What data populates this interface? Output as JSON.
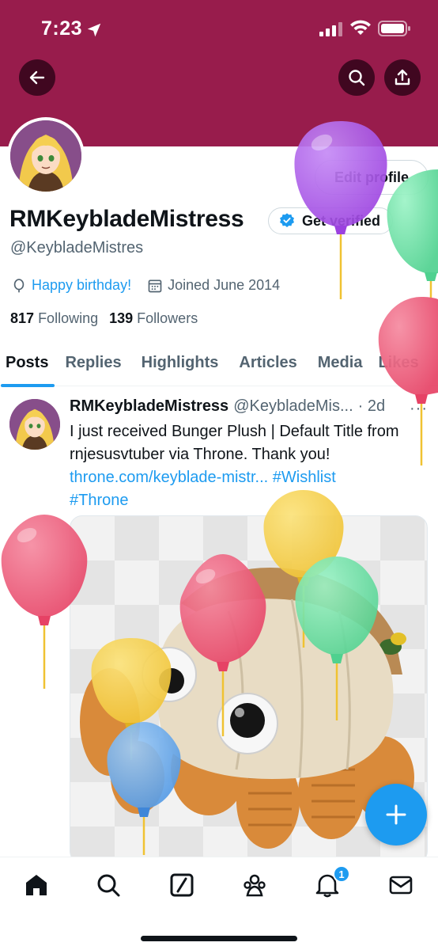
{
  "status_bar": {
    "time": "7:23"
  },
  "header": {
    "back_icon": "arrow-left-icon",
    "search_icon": "search-icon",
    "share_icon": "share-icon"
  },
  "profile": {
    "edit_label": "Edit profile",
    "display_name": "RMKeybladeMistress",
    "verify_label": "Get verified",
    "handle": "@KeybladeMistres",
    "birthday": "Happy birthday!",
    "joined": "Joined June 2014",
    "following_count": "817",
    "following_label": "Following",
    "followers_count": "139",
    "followers_label": "Followers"
  },
  "tabs": [
    {
      "label": "Posts"
    },
    {
      "label": "Replies"
    },
    {
      "label": "Highlights"
    },
    {
      "label": "Articles"
    },
    {
      "label": "Media"
    },
    {
      "label": "Likes"
    }
  ],
  "tweet": {
    "name": "RMKeybladeMistress",
    "handle": "@KeybladeMis...",
    "time": "· 2d",
    "more": "···",
    "text": "I just received Bunger Plush | Default Title from rnjesusvtuber via Throne. Thank you!",
    "link": "throne.com/keyblade-mistr...",
    "tag1": "#Wishlist",
    "tag2": "#Throne"
  },
  "notifications": {
    "badge": "1"
  },
  "colors": {
    "banner": "#981c4c",
    "accent": "#1d9bf0"
  }
}
